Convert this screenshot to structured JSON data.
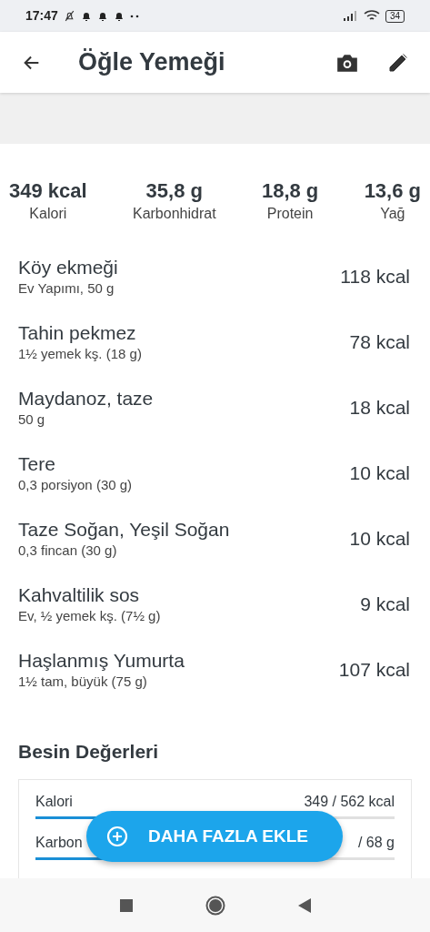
{
  "status_bar": {
    "time": "17:47",
    "battery": "34"
  },
  "header": {
    "title": "Öğle Yemeği"
  },
  "summary": [
    {
      "value": "349 kcal",
      "label": "Kalori"
    },
    {
      "value": "35,8 g",
      "label": "Karbonhidrat"
    },
    {
      "value": "18,8 g",
      "label": "Protein"
    },
    {
      "value": "13,6 g",
      "label": "Yağ"
    }
  ],
  "foods": [
    {
      "name": "Köy ekmeği",
      "portion": "Ev Yapımı, 50 g",
      "calories": "118 kcal"
    },
    {
      "name": "Tahin pekmez",
      "portion": "1½ yemek kş. (18 g)",
      "calories": "78 kcal"
    },
    {
      "name": "Maydanoz, taze",
      "portion": "50 g",
      "calories": "18 kcal"
    },
    {
      "name": "Tere",
      "portion": "0,3 porsiyon (30 g)",
      "calories": "10 kcal"
    },
    {
      "name": "Taze Soğan, Yeşil Soğan",
      "portion": "0,3 fincan (30 g)",
      "calories": "10 kcal"
    },
    {
      "name": "Kahvaltilik sos",
      "portion": "Ev, ½ yemek kş. (7½ g)",
      "calories": "9 kcal"
    },
    {
      "name": "Haşlanmış Yumurta",
      "portion": "1½ tam, büyük (75 g)",
      "calories": "107 kcal"
    }
  ],
  "nutrients": {
    "title": "Besin Değerleri",
    "items": [
      {
        "label": "Kalori",
        "reading": "349 / 562 kcal",
        "level": 0.62
      },
      {
        "label": "Karbon",
        "reading": "/ 68 g",
        "level": 0.53
      }
    ]
  },
  "fab": {
    "label": "DAHA FAZLA EKLE"
  }
}
